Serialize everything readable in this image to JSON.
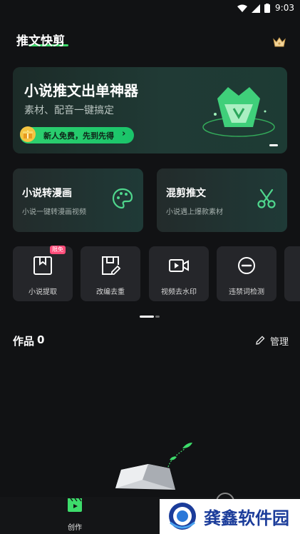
{
  "status_bar": {
    "time": "9:03"
  },
  "header": {
    "title": "推文快剪"
  },
  "banner": {
    "title": "小说推文出单神器",
    "subtitle": "素材、配音一键搞定",
    "button_label": "新人免费，先到先得",
    "button_arrow": "›"
  },
  "cards": [
    {
      "title": "小说转漫画",
      "subtitle": "小说一键转漫画视频",
      "icon": "palette-icon"
    },
    {
      "title": "混剪推文",
      "subtitle": "小说遇上爆款素材",
      "icon": "scissors-icon"
    }
  ],
  "tools": [
    {
      "label": "小说提取",
      "icon": "extract-icon",
      "badge": "限免"
    },
    {
      "label": "改编去重",
      "icon": "edit-doc-icon"
    },
    {
      "label": "视频去水印",
      "icon": "video-icon"
    },
    {
      "label": "违禁词检测",
      "icon": "forbidden-icon"
    }
  ],
  "works": {
    "label": "作品",
    "count": "0",
    "manage_label": "管理"
  },
  "bottom_nav": {
    "create_label": "创作"
  },
  "watermark": {
    "text": "龚鑫软件园"
  },
  "colors": {
    "accent": "#3ddc6b",
    "background": "#111214",
    "badge": "#ff4d7a"
  }
}
